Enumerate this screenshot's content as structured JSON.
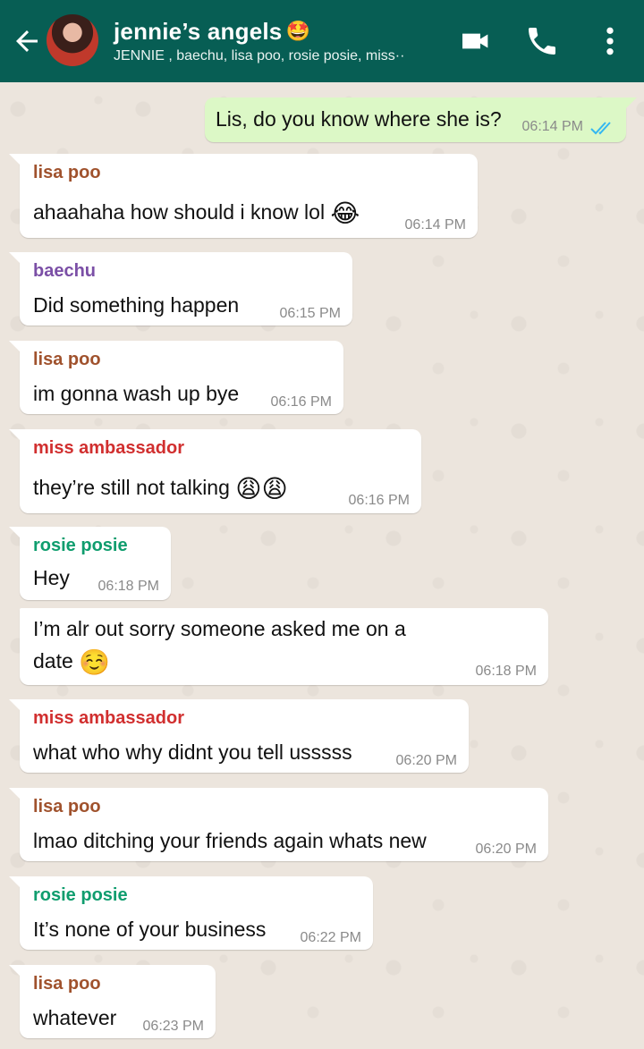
{
  "header": {
    "title": "jennie’s angels",
    "title_emoji": "🤩",
    "subtitle": "JENNIE , baechu, lisa poo, rosie posie, miss··",
    "icons": [
      "back-arrow-icon",
      "video-call-icon",
      "voice-call-icon",
      "more-options-icon"
    ]
  },
  "colors": {
    "header": "#075e54",
    "incoming_bubble": "#ffffff",
    "outgoing_bubble": "#dcf8c6",
    "read_ticks": "#34b7f1",
    "lisa_poo": "#a0522d",
    "baechu": "#7b4fa6",
    "miss_ambassador": "#d12f2f",
    "rosie_posie": "#0f9d6e"
  },
  "messages": [
    {
      "direction": "out",
      "text": "Lis, do you know where she is?",
      "time": "06:14 PM",
      "status": "read"
    },
    {
      "direction": "in",
      "sender": "lisa poo",
      "text": "ahaahaha how should i know lol",
      "emoji": "😂",
      "time": "06:14 PM"
    },
    {
      "direction": "in",
      "sender": "baechu",
      "text": "Did something happen",
      "time": "06:15 PM"
    },
    {
      "direction": "in",
      "sender": "lisa poo",
      "text": "im gonna wash up bye",
      "time": "06:16 PM"
    },
    {
      "direction": "in",
      "sender": "miss ambassador",
      "text": "they’re still not talking",
      "emoji": "😩😩",
      "time": "06:16 PM"
    },
    {
      "direction": "in",
      "sender": "rosie posie",
      "text": "Hey",
      "time": "06:18 PM"
    },
    {
      "direction": "in",
      "sender": "",
      "text": "I’m alr out sorry someone asked me on a",
      "text2": "date",
      "emoji": "☺️",
      "time": "06:18 PM"
    },
    {
      "direction": "in",
      "sender": "miss ambassador",
      "text": "what who why didnt you tell usssss",
      "time": "06:20 PM"
    },
    {
      "direction": "in",
      "sender": "lisa poo",
      "text": "lmao ditching your friends again whats new",
      "time": "06:20 PM"
    },
    {
      "direction": "in",
      "sender": "rosie posie",
      "text": "It’s none of your business",
      "time": "06:22 PM"
    },
    {
      "direction": "in",
      "sender": "lisa poo",
      "text": "whatever",
      "time": "06:23 PM"
    }
  ]
}
